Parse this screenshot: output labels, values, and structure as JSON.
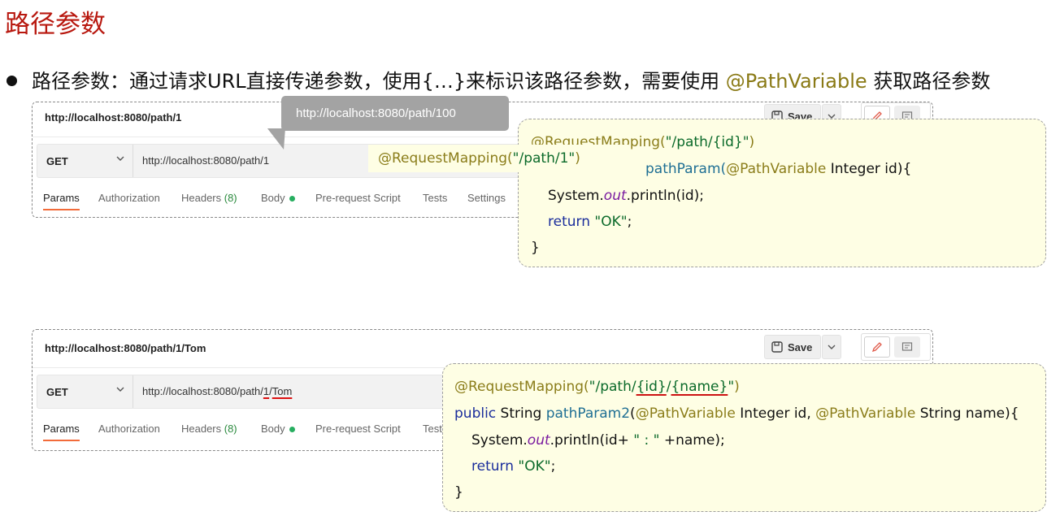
{
  "slide": {
    "title": "路径参数",
    "bullet": {
      "prefix": "路径参数：通过请求URL直接传递参数，使用{…}来标识该路径参数，需要使用 ",
      "highlight": "@PathVariable",
      "suffix": " 获取路径参数"
    }
  },
  "request1": {
    "title_url": "http://localhost:8080/path/1",
    "method": "GET",
    "url": "http://localhost:8080/path/1",
    "save_label": "Save",
    "tabs": [
      {
        "label": "Params"
      },
      {
        "label": "Authorization"
      },
      {
        "label": "Headers ",
        "count": "(8)"
      },
      {
        "label": "Body"
      },
      {
        "label": "Pre-request Script"
      },
      {
        "label": "Tests"
      },
      {
        "label": "Settings"
      }
    ]
  },
  "tooltip": {
    "text": "http://localhost:8080/path/100"
  },
  "code1": {
    "annotation_prefix": "@RequestMapping(",
    "annotation_path": "\"/path/{id}\"",
    "annotation_suffix": ")",
    "sig_tail": "pathParam(",
    "sig_param_ann": "@PathVariable",
    "sig_param_rest": " Integer id){",
    "print_prefix": "System.",
    "print_field": "out",
    "print_suffix": ".println(id);",
    "return_kw": "return",
    "return_val": " \"OK\"",
    "return_end": ";",
    "close": "}"
  },
  "mini_annotation": {
    "prefix": "@RequestMapping(",
    "path": "\"/path/1\"",
    "suffix": ")"
  },
  "request2": {
    "title_url": "http://localhost:8080/path/1/Tom",
    "method": "GET",
    "url_base": "http://localhost:8080/path/",
    "url_id": "1",
    "url_sep": "/",
    "url_name": "Tom",
    "save_label": "Save",
    "tabs": [
      {
        "label": "Params"
      },
      {
        "label": "Authorization"
      },
      {
        "label": "Headers ",
        "count": "(8)"
      },
      {
        "label": "Body"
      },
      {
        "label": "Pre-request Script"
      },
      {
        "label": "Test"
      }
    ]
  },
  "code2": {
    "annotation_prefix": "@RequestMapping(",
    "q_open": "\"/path/",
    "id_part": "{id}",
    "slash": "/",
    "name_part": "{name}",
    "q_close": "\"",
    "annotation_suffix": ")",
    "kw_public": "public",
    "type_string": " String ",
    "method_name": "pathParam2",
    "paren": "(",
    "ann1": "@PathVariable",
    "p1": " Integer id, ",
    "ann2": "@PathVariable",
    "p2": " String name){",
    "print_prefix": "System.",
    "print_field": "out",
    "print_mid": ".println(id+ ",
    "print_str": "\" : \"",
    "print_end": " +name);",
    "return_kw": "return",
    "return_val": " \"OK\"",
    "return_end": ";",
    "close": "}"
  },
  "colors": {
    "title_red": "#b8180f",
    "annotation": "#8b7d1a",
    "string": "#0b6a2a",
    "keyword": "#1b2e9c",
    "tab_active_underline": "#f26b3a",
    "code_bg": "#fefee4"
  }
}
